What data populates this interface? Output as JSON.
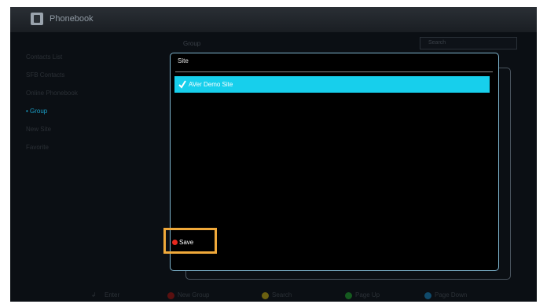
{
  "header": {
    "title": "Phonebook",
    "icon": "phonebook-icon"
  },
  "sidebar": {
    "items": [
      {
        "label": "Contacts List"
      },
      {
        "label": "SFB Contacts"
      },
      {
        "label": "Online Phonebook"
      },
      {
        "label": "• Group"
      },
      {
        "label": "New Site"
      },
      {
        "label": "Favorite"
      }
    ]
  },
  "background": {
    "group_label": "Group",
    "search_placeholder": "Search"
  },
  "dialog": {
    "title": "Site",
    "sites": [
      {
        "label": "AVer Demo Site",
        "checked": true
      }
    ],
    "save_label": "Save"
  },
  "footer": {
    "enter": "Enter",
    "new_group": "New Group",
    "search": "Search",
    "page_up": "Page Up",
    "page_down": "Page Down"
  },
  "colors": {
    "accent": "#17cfec",
    "highlight_border": "#f0a93a",
    "red": "#e6281f",
    "yellow": "#d6c21c",
    "green": "#2fae3d",
    "blue": "#1f8fd6"
  }
}
